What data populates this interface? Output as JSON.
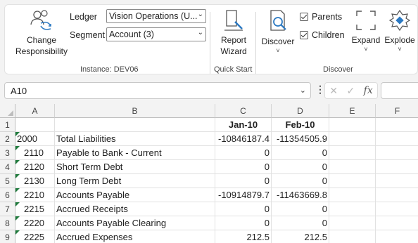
{
  "ribbon": {
    "change_responsibility": {
      "line1": "Change",
      "line2": "Responsibility"
    },
    "ledger": {
      "label": "Ledger",
      "value": "Vision Operations (U..."
    },
    "segment": {
      "label": "Segment",
      "value": "Account (3)"
    },
    "instance_label": "Instance: DEV06",
    "report_wizard": {
      "line1": "Report",
      "line2": "Wizard"
    },
    "quick_start_label": "Quick Start",
    "discover": {
      "label": "Discover",
      "caret": "˅"
    },
    "parents": {
      "label": "Parents",
      "checked": true
    },
    "children": {
      "label": "Children",
      "checked": true
    },
    "expand": {
      "label": "Expand",
      "caret": "˅"
    },
    "explode": {
      "label": "Explode",
      "caret": "˅"
    },
    "discover_group_label": "Discover"
  },
  "formula_bar": {
    "name_box": "A10",
    "fx": "fx"
  },
  "sheet": {
    "columns": [
      "A",
      "B",
      "C",
      "D",
      "E",
      "F"
    ],
    "rows": [
      {
        "num": "1",
        "a": "",
        "b": "",
        "c": "Jan-10",
        "d": "Feb-10",
        "header": true
      },
      {
        "num": "2",
        "a": "2000",
        "b": "Total Liabilities",
        "c": "-10846187.4",
        "d": "-11354505.9"
      },
      {
        "num": "3",
        "a": "2110",
        "b": "Payable to Bank - Current",
        "c": "0",
        "d": "0"
      },
      {
        "num": "4",
        "a": "2120",
        "b": "Short Term Debt",
        "c": "0",
        "d": "0"
      },
      {
        "num": "5",
        "a": "2130",
        "b": "Long Term Debt",
        "c": "0",
        "d": "0"
      },
      {
        "num": "6",
        "a": "2210",
        "b": "Accounts Payable",
        "c": "-10914879.7",
        "d": "-11463669.8"
      },
      {
        "num": "7",
        "a": "2215",
        "b": "Accrued Receipts",
        "c": "0",
        "d": "0"
      },
      {
        "num": "8",
        "a": "2220",
        "b": "Accounts Payable Clearing",
        "c": "0",
        "d": "0"
      },
      {
        "num": "9",
        "a": "2225",
        "b": "Accrued Expenses",
        "c": "212.5",
        "d": "212.5"
      }
    ]
  },
  "colors": {
    "accent_green": "#1e7b3c",
    "icon_blue": "#2b79c2"
  }
}
